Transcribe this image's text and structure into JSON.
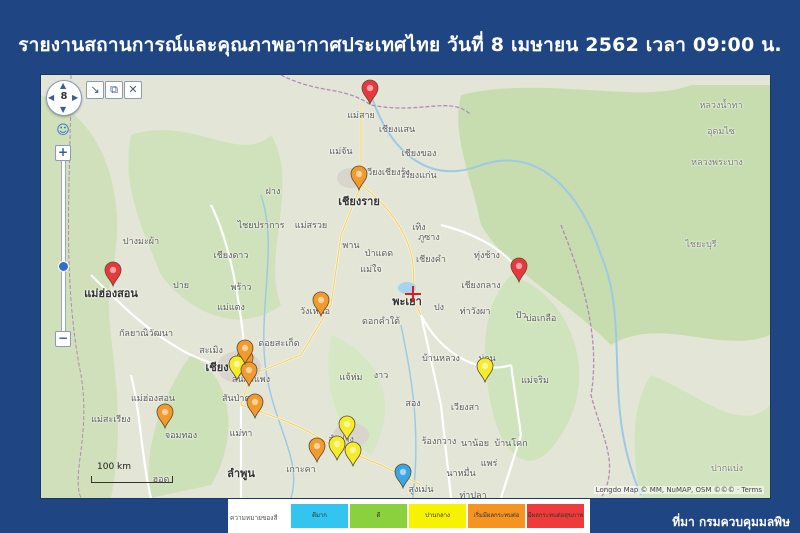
{
  "title": "รายงานสถานการณ์และคุณภาพอากาศประเทศไทย วันที่ 8 เมษายน 2562 เวลา 09:00 น.",
  "source": "ที่มา กรมควบคุมมลพิษ",
  "map": {
    "zoom_level": "8",
    "scale_label": "100 km",
    "attribution": "Longdo Map © MM, NuMAP, OSM ©©© · Terms",
    "places": [
      {
        "name": "เชียงราย",
        "big": true,
        "foreign": false
      },
      {
        "name": "พะเยา",
        "big": true,
        "foreign": false
      },
      {
        "name": "เชียงใหม่",
        "big": true,
        "foreign": false
      },
      {
        "name": "แม่ฮ่องสอน",
        "big": true,
        "foreign": false
      },
      {
        "name": "ลำพูน",
        "big": true,
        "foreign": false
      },
      {
        "name": "แม่สาย",
        "big": false,
        "foreign": false
      },
      {
        "name": "เชียงแสน",
        "big": false,
        "foreign": false
      },
      {
        "name": "เชียงของ",
        "big": false,
        "foreign": false
      },
      {
        "name": "เวียงแก่น",
        "big": false,
        "foreign": false
      },
      {
        "name": "แม่จัน",
        "big": false,
        "foreign": false
      },
      {
        "name": "เวียงเชียงรุ้ง",
        "big": false,
        "foreign": false
      },
      {
        "name": "ฝาง",
        "big": false,
        "foreign": false
      },
      {
        "name": "ไชยปราการ",
        "big": false,
        "foreign": false
      },
      {
        "name": "แม่สรวย",
        "big": false,
        "foreign": false
      },
      {
        "name": "พาน",
        "big": false,
        "foreign": false
      },
      {
        "name": "ป่าแดด",
        "big": false,
        "foreign": false
      },
      {
        "name": "เทิง",
        "big": false,
        "foreign": false
      },
      {
        "name": "ภูซาง",
        "big": false,
        "foreign": false
      },
      {
        "name": "เชียงดาว",
        "big": false,
        "foreign": false
      },
      {
        "name": "ปางมะผ้า",
        "big": false,
        "foreign": false
      },
      {
        "name": "ปาย",
        "big": false,
        "foreign": false
      },
      {
        "name": "แม่ใจ",
        "big": false,
        "foreign": false
      },
      {
        "name": "เชียงคำ",
        "big": false,
        "foreign": false
      },
      {
        "name": "ทุ่งช้าง",
        "big": false,
        "foreign": false
      },
      {
        "name": "เชียงกลาง",
        "big": false,
        "foreign": false
      },
      {
        "name": "พร้าว",
        "big": false,
        "foreign": false
      },
      {
        "name": "แม่แตง",
        "big": false,
        "foreign": false
      },
      {
        "name": "วังเหนือ",
        "big": false,
        "foreign": false
      },
      {
        "name": "ดอกคำใต้",
        "big": false,
        "foreign": false
      },
      {
        "name": "ปง",
        "big": false,
        "foreign": false
      },
      {
        "name": "ท่าวังผา",
        "big": false,
        "foreign": false
      },
      {
        "name": "ปัว",
        "big": false,
        "foreign": false
      },
      {
        "name": "บ่อเกลือ",
        "big": false,
        "foreign": false
      },
      {
        "name": "กัลยาณิวัฒนา",
        "big": false,
        "foreign": false
      },
      {
        "name": "ดอยสะเก็ด",
        "big": false,
        "foreign": false
      },
      {
        "name": "สะเมิง",
        "big": false,
        "foreign": false
      },
      {
        "name": "บ้านหลวง",
        "big": false,
        "foreign": false
      },
      {
        "name": "น่าน",
        "big": false,
        "foreign": false
      },
      {
        "name": "แม่ฮ่องสอน",
        "big": false,
        "foreign": false
      },
      {
        "name": "สันกำแพง",
        "big": false,
        "foreign": false
      },
      {
        "name": "แจ้ห่ม",
        "big": false,
        "foreign": false
      },
      {
        "name": "งาว",
        "big": false,
        "foreign": false
      },
      {
        "name": "แม่จริม",
        "big": false,
        "foreign": false
      },
      {
        "name": "สันป่าตอง",
        "big": false,
        "foreign": false
      },
      {
        "name": "สอง",
        "big": false,
        "foreign": false
      },
      {
        "name": "เวียงสา",
        "big": false,
        "foreign": false
      },
      {
        "name": "แม่สะเรียง",
        "big": false,
        "foreign": false
      },
      {
        "name": "ฮอด",
        "big": false,
        "foreign": false
      },
      {
        "name": "แม่ทา",
        "big": false,
        "foreign": false
      },
      {
        "name": "ร้องกวาง",
        "big": false,
        "foreign": false
      },
      {
        "name": "นาน้อย",
        "big": false,
        "foreign": false
      },
      {
        "name": "ลำปาง",
        "big": false,
        "foreign": false
      },
      {
        "name": "สูงเม่น",
        "big": false,
        "foreign": false
      },
      {
        "name": "แพร่",
        "big": false,
        "foreign": false
      },
      {
        "name": "เกาะคา",
        "big": false,
        "foreign": false
      },
      {
        "name": "นาหมื่น",
        "big": false,
        "foreign": false
      },
      {
        "name": "บ้านโคก",
        "big": false,
        "foreign": false
      },
      {
        "name": "ท่าปลา",
        "big": false,
        "foreign": false
      },
      {
        "name": "จอมทอง",
        "big": false,
        "foreign": false
      },
      {
        "name": "หลวงน้ำทา",
        "big": false,
        "foreign": true
      },
      {
        "name": "อุดมไซ",
        "big": false,
        "foreign": true
      },
      {
        "name": "หลวงพระบาง",
        "big": false,
        "foreign": true
      },
      {
        "name": "ไชยะบุรี",
        "big": false,
        "foreign": true
      },
      {
        "name": "ปากแบ่ง",
        "big": false,
        "foreign": true
      }
    ],
    "stations": [
      {
        "level": "red"
      },
      {
        "level": "orange"
      },
      {
        "level": "red"
      },
      {
        "level": "red"
      },
      {
        "level": "orange"
      },
      {
        "level": "orange"
      },
      {
        "level": "yellow"
      },
      {
        "level": "orange"
      },
      {
        "level": "orange"
      },
      {
        "level": "orange"
      },
      {
        "level": "yellow"
      },
      {
        "level": "yellow"
      },
      {
        "level": "orange"
      },
      {
        "level": "yellow"
      },
      {
        "level": "yellow"
      },
      {
        "level": "blue"
      },
      {
        "level": "orange"
      }
    ]
  },
  "legend": {
    "label": "ความหมายของสี",
    "items": [
      {
        "text": "ดีมาก",
        "color": "#33c4f0"
      },
      {
        "text": "ดี",
        "color": "#8bd13d"
      },
      {
        "text": "ปานกลาง",
        "color": "#f7f200"
      },
      {
        "text": "เริ่มมีผลกระทบต่อสุขภาพ",
        "color": "#f59420"
      },
      {
        "text": "มีผลกระทบต่อสุขภาพ",
        "color": "#ef3b3b"
      }
    ]
  },
  "colors": {
    "red": "#e8383d",
    "orange": "#f39a2c",
    "yellow": "#f4ec2a",
    "blue": "#3aa6e4",
    "background": "#1f4582"
  }
}
